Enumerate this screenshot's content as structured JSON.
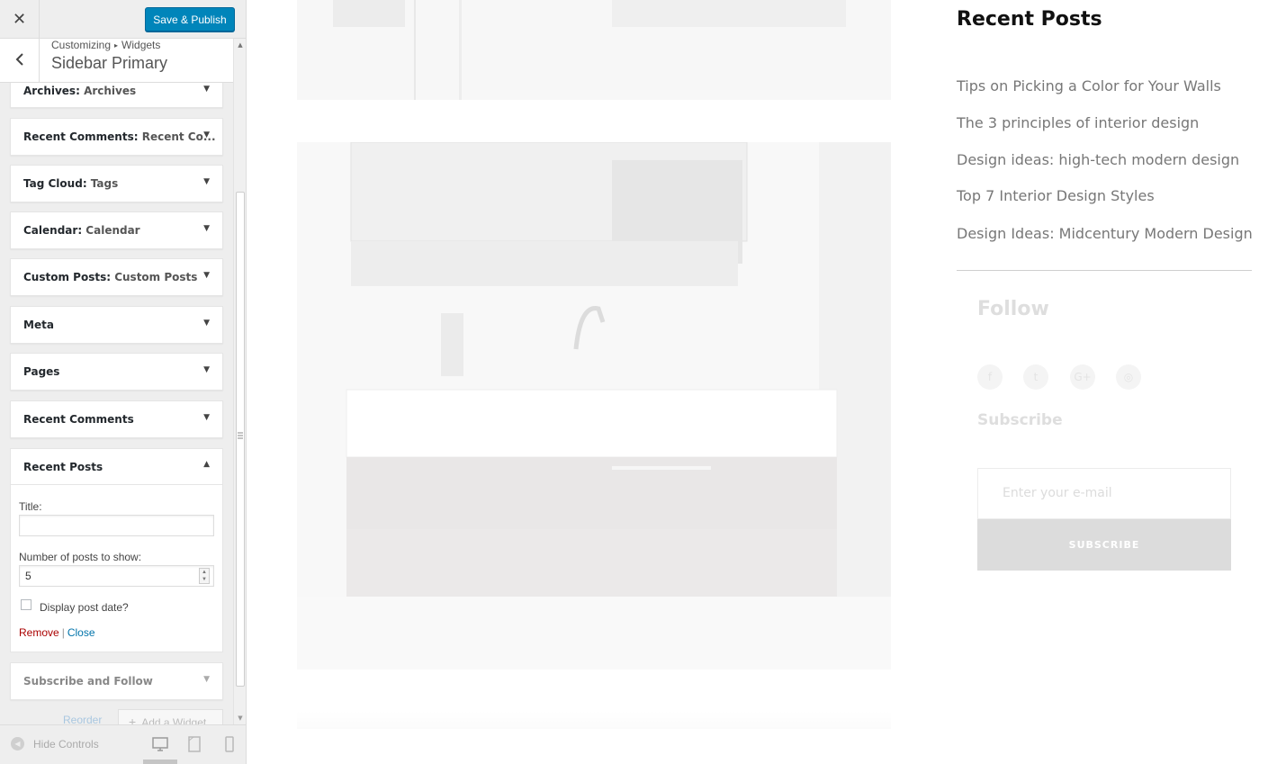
{
  "header": {
    "close_glyph": "✕",
    "publish_label": "Save & Publish"
  },
  "section": {
    "breadcrumb_root": "Customizing",
    "breadcrumb_sep": "▸",
    "breadcrumb_leaf": "Widgets",
    "title": "Sidebar Primary",
    "back_glyph": "‹"
  },
  "widgets": [
    {
      "name": "Archives",
      "instance": "Archives"
    },
    {
      "name": "Recent Comments",
      "instance": "Recent Co..."
    },
    {
      "name": "Tag Cloud",
      "instance": "Tags"
    },
    {
      "name": "Calendar",
      "instance": "Calendar"
    },
    {
      "name": "Custom Posts",
      "instance": "Custom Posts"
    },
    {
      "name": "Meta",
      "instance": ""
    },
    {
      "name": "Pages",
      "instance": ""
    },
    {
      "name": "Recent Comments",
      "instance": ""
    },
    {
      "name": "Recent Posts",
      "instance": ""
    },
    {
      "name": "Subscribe and Follow",
      "instance": ""
    }
  ],
  "open_widget": {
    "title_label": "Title:",
    "title_value": "",
    "count_label": "Number of posts to show:",
    "count_value": "5",
    "date_label": "Display post date?",
    "date_checked": false,
    "remove_label": "Remove",
    "close_label": "Close"
  },
  "widget_actions": {
    "reorder_label": "Reorder",
    "add_label": "Add a Widget"
  },
  "footer": {
    "hide_label": "Hide Controls"
  },
  "preview": {
    "recent_posts_title": "Recent Posts",
    "posts": [
      "Tips on Picking a Color for Your Walls",
      "The 3 principles of interior design",
      "Design ideas: high-tech modern design",
      "Top 7 Interior Design Styles",
      "Design Ideas: Midcentury Modern Design"
    ],
    "follow_title": "Follow",
    "social_icons": [
      "f",
      "t",
      "G+",
      "◎"
    ],
    "subscribe_title": "Subscribe",
    "email_placeholder": "Enter your e-mail",
    "subscribe_button": "SUBSCRIBE"
  }
}
